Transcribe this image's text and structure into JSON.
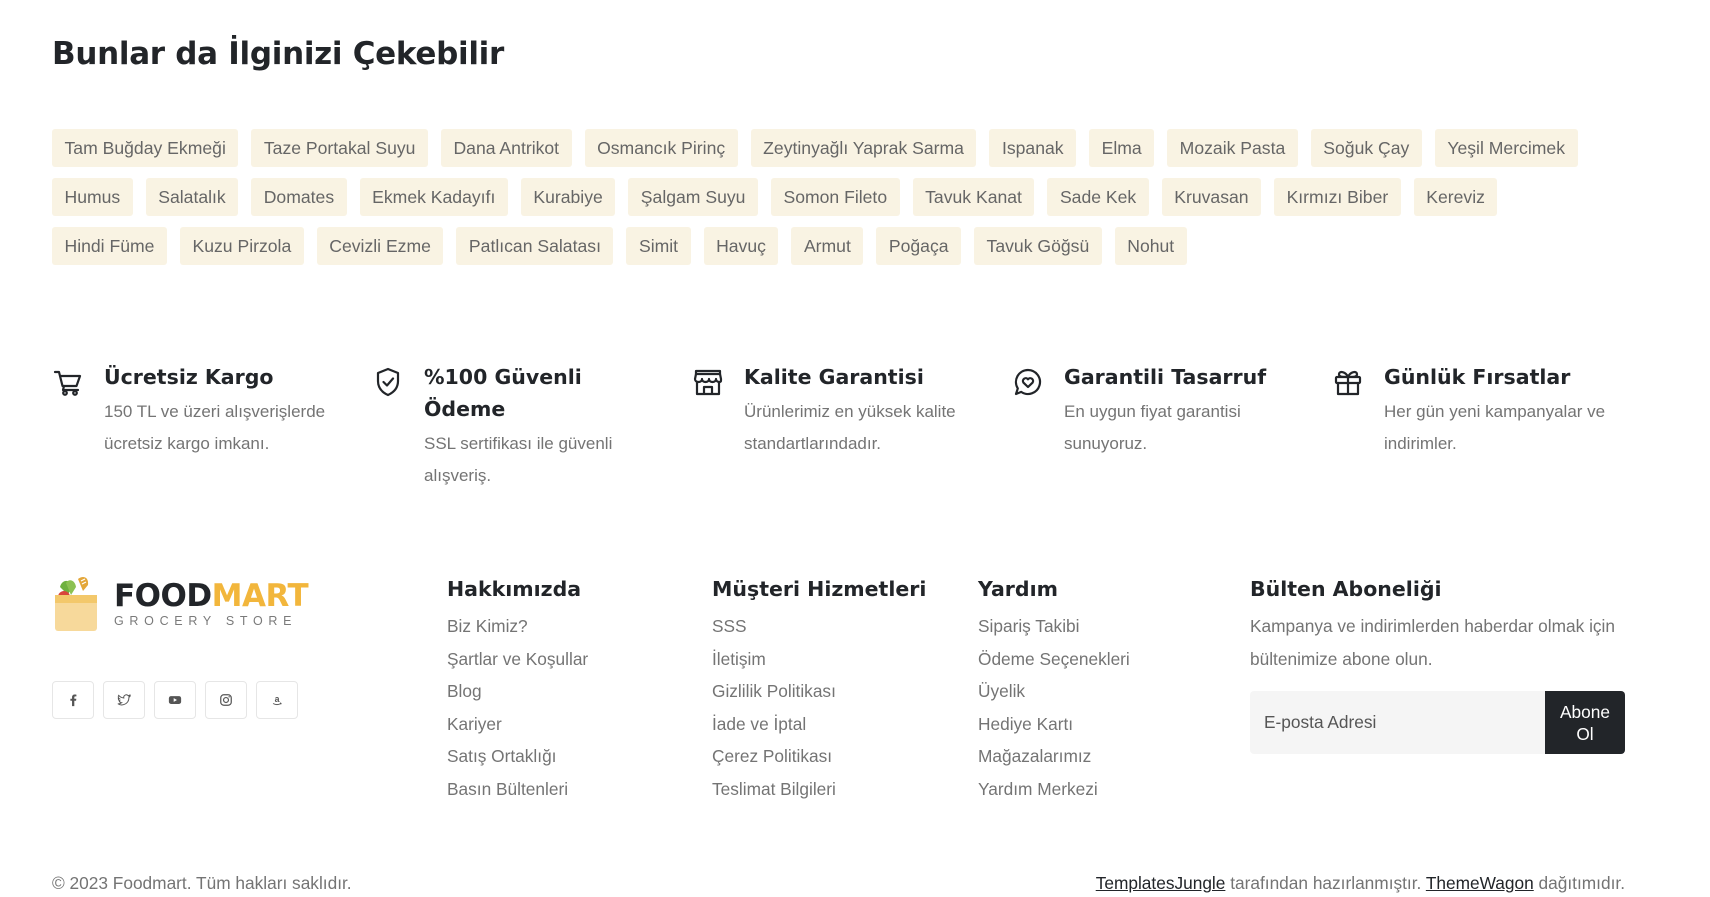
{
  "related": {
    "title": "Bunlar da İlginizi Çekebilir",
    "tags": [
      "Tam Buğday Ekmeği",
      "Taze Portakal Suyu",
      "Dana Antrikot",
      "Osmancık Pirinç",
      "Zeytinyağlı Yaprak Sarma",
      "Ispanak",
      "Elma",
      "Mozaik Pasta",
      "Soğuk Çay",
      "Yeşil Mercimek",
      "Humus",
      "Salatalık",
      "Domates",
      "Ekmek Kadayıfı",
      "Kurabiye",
      "Şalgam Suyu",
      "Somon Fileto",
      "Tavuk Kanat",
      "Sade Kek",
      "Kruvasan",
      "Kırmızı Biber",
      "Kereviz",
      "Hindi Füme",
      "Kuzu Pirzola",
      "Cevizli Ezme",
      "Patlıcan Salatası",
      "Simit",
      "Havuç",
      "Armut",
      "Poğaça",
      "Tavuk Göğsü",
      "Nohut"
    ]
  },
  "features": [
    {
      "icon": "cart-icon",
      "title": "Ücretsiz Kargo",
      "text": "150 TL ve üzeri alışverişlerde ücretsiz kargo imkanı."
    },
    {
      "icon": "shield-check-icon",
      "title": "%100 Güvenli Ödeme",
      "text": "SSL sertifikası ile güvenli alışveriş."
    },
    {
      "icon": "store-icon",
      "title": "Kalite Garantisi",
      "text": "Ürünlerimiz en yüksek kalite standartlarındadır."
    },
    {
      "icon": "heart-chat-icon",
      "title": "Garantili Tasarruf",
      "text": "En uygun fiyat garantisi sunuyoruz."
    },
    {
      "icon": "gift-icon",
      "title": "Günlük Fırsatlar",
      "text": "Her gün yeni kampanyalar ve indirimler."
    }
  ],
  "brand": {
    "name_part1": "FOOD",
    "name_part2": "MART",
    "tagline": "GROCERY STORE",
    "accent": "#f2b63c"
  },
  "socials": [
    "facebook-icon",
    "twitter-icon",
    "youtube-icon",
    "instagram-icon",
    "amazon-icon"
  ],
  "footer": {
    "columns": [
      {
        "title": "Hakkımızda",
        "links": [
          "Biz Kimiz?",
          "Şartlar ve Koşullar",
          "Blog",
          "Kariyer",
          "Satış Ortaklığı",
          "Basın Bültenleri"
        ]
      },
      {
        "title": "Müşteri Hizmetleri",
        "links": [
          "SSS",
          "İletişim",
          "Gizlilik Politikası",
          "İade ve İptal",
          "Çerez Politikası",
          "Teslimat Bilgileri"
        ]
      },
      {
        "title": "Yardım",
        "links": [
          "Sipariş Takibi",
          "Ödeme Seçenekleri",
          "Üyelik",
          "Hediye Kartı",
          "Mağazalarımız",
          "Yardım Merkezi"
        ]
      }
    ],
    "newsletter": {
      "title": "Bülten Aboneliği",
      "text": "Kampanya ve indirimlerden haberdar olmak için bültenimize abone olun.",
      "placeholder": "E-posta Adresi",
      "button": "Abone Ol"
    },
    "copyright": "© 2023 Foodmart. Tüm hakları saklıdır.",
    "credit_link1": "TemplatesJungle",
    "credit_mid": " tarafından hazırlanmıştır. ",
    "credit_link2": "ThemeWagon",
    "credit_end": " dağıtımıdır."
  }
}
